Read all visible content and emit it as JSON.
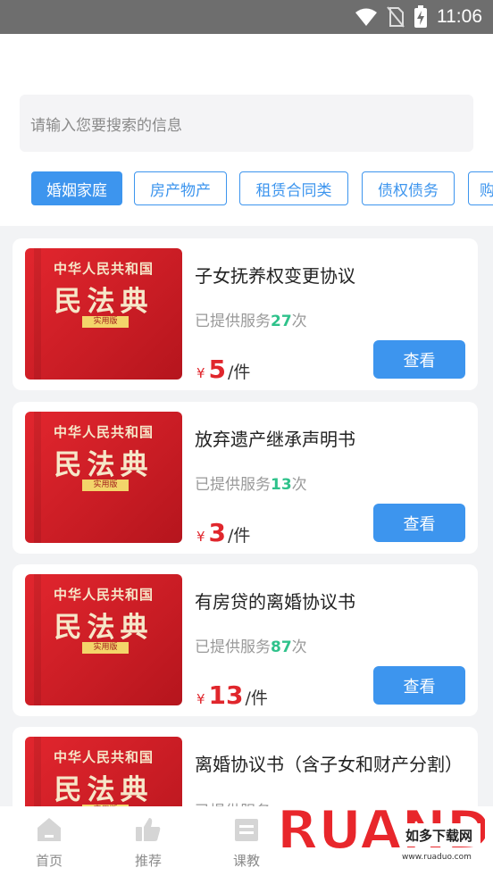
{
  "status_bar": {
    "time": "11:06",
    "icons": [
      "wifi-icon",
      "no-sim-icon",
      "battery-charging-icon"
    ]
  },
  "search": {
    "placeholder": "请输入您要搜索的信息"
  },
  "tabs": [
    {
      "label": "婚姻家庭",
      "active": true
    },
    {
      "label": "房产物产",
      "active": false
    },
    {
      "label": "租赁合同类",
      "active": false
    },
    {
      "label": "债权债务",
      "active": false
    },
    {
      "label": "购",
      "active": false
    }
  ],
  "book_cover": {
    "line1": "中华人民共和国",
    "line2": "民法典",
    "line3": "实用版"
  },
  "currency_symbol": "¥",
  "view_label": "查看",
  "served_prefix": "已提供服务",
  "served_suffix": "次",
  "price_unit": "/件",
  "items": [
    {
      "title": "子女抚养权变更协议",
      "served_count": "27",
      "price": "5"
    },
    {
      "title": "放弃遗产继承声明书",
      "served_count": "13",
      "price": "3"
    },
    {
      "title": "有房贷的离婚协议书",
      "served_count": "87",
      "price": "13"
    },
    {
      "title": "离婚协议书（含子女和财产分割）",
      "served_count": "",
      "price": ""
    }
  ],
  "tabbar": [
    {
      "label": "首页",
      "icon": "home-icon"
    },
    {
      "label": "推荐",
      "icon": "thumbs-up-icon"
    },
    {
      "label": "课教",
      "icon": "document-list-icon"
    }
  ],
  "watermark": {
    "text_main": "RUANDAO",
    "text_cn": "如多下载网",
    "url": "www.ruaduo.com"
  },
  "colors": {
    "accent": "#3d95ee",
    "price": "#e0262c",
    "count": "#2fc28b",
    "status_bar": "#6e6e6e"
  }
}
